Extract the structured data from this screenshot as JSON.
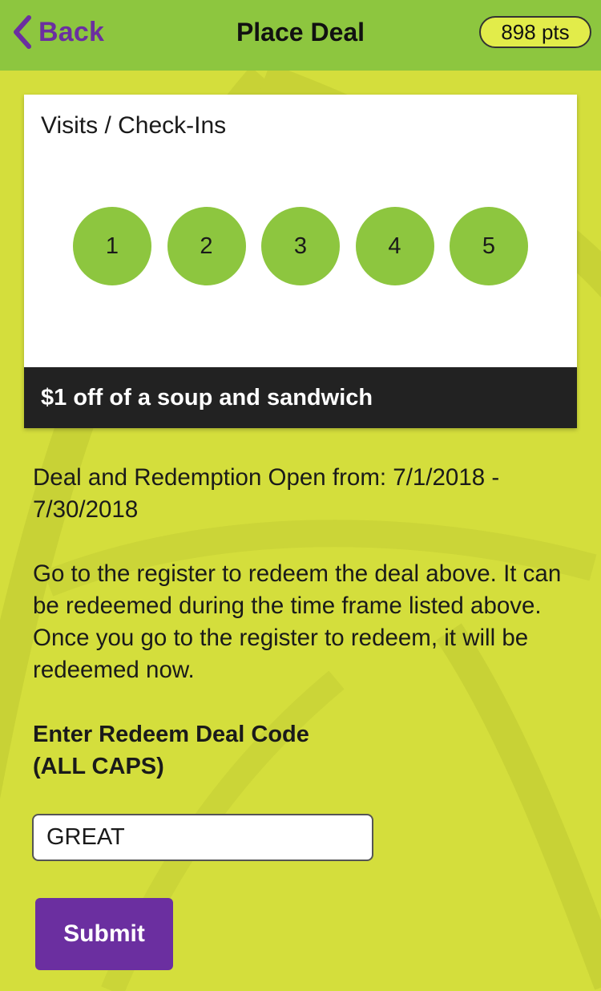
{
  "nav": {
    "back_label": "Back",
    "title": "Place Deal",
    "points": "898 pts",
    "bar_color": "#8dc63f",
    "accent_color": "#6b2fa0"
  },
  "card": {
    "heading": "Visits / Check-Ins",
    "checkins": [
      "1",
      "2",
      "3",
      "4",
      "5"
    ],
    "deal_name": "$1 off of a soup and sandwich"
  },
  "details": {
    "dates": "Deal and Redemption Open from: 7/1/2018 - 7/30/2018",
    "instructions": "Go to the register to redeem the deal above. It can be redeemed during the time frame listed above. Once you go to the register to redeem, it will be redeemed now.",
    "code_label_line1": "Enter Redeem Deal Code",
    "code_label_line2": "(ALL CAPS)"
  },
  "form": {
    "code_value": "GREAT",
    "submit_label": "Submit"
  },
  "icons": {
    "back": "chevron-left-icon"
  },
  "page_background": "#d4de3c"
}
